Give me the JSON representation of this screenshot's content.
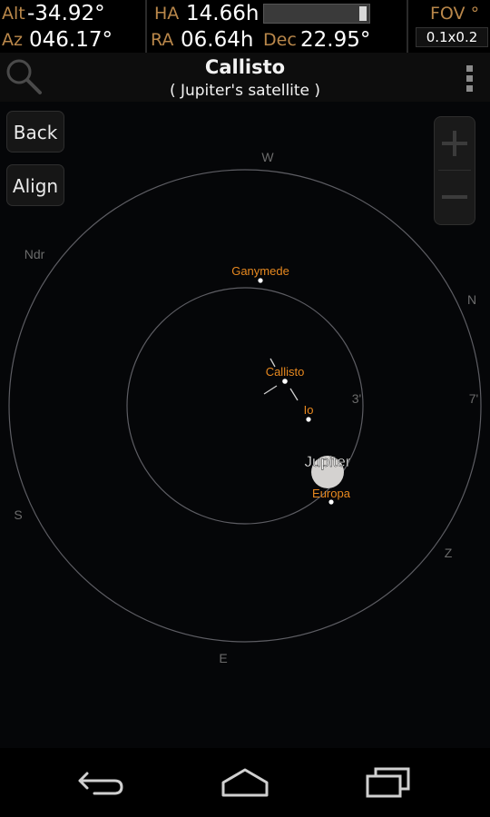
{
  "status": {
    "alt_label": "Alt",
    "alt_value": "-34.92°",
    "az_label": "Az",
    "az_value": "046.17°",
    "ha_label": "HA",
    "ha_value": "14.66h",
    "ra_label": "RA",
    "ra_value": "06.64h",
    "dec_label": "Dec",
    "dec_value": "22.95°",
    "fov_label": "FOV °",
    "fov_value": "0.1x0.2"
  },
  "header": {
    "title": "Callisto",
    "subtitle": "( Jupiter's satellite )"
  },
  "buttons": {
    "back": "Back",
    "align": "Align"
  },
  "sky": {
    "directions": {
      "w": "W",
      "n": "N",
      "s": "S",
      "e": "E",
      "z": "Z",
      "ndr": "Ndr"
    },
    "ring_labels": {
      "inner": "3'",
      "outer": "7'"
    },
    "objects": {
      "ganymede": "Ganymede",
      "callisto": "Callisto",
      "io": "Io",
      "jupiter": "Jupiter",
      "europa": "Europa"
    }
  },
  "colors": {
    "accent": "#e8891f",
    "label": "#b9874a"
  },
  "icons": {
    "search": "search-icon",
    "overflow": "overflow-menu-icon",
    "zoom_in": "zoom-in-icon",
    "zoom_out": "zoom-out-icon",
    "back_nav": "back-nav-icon",
    "home": "home-icon",
    "recents": "recents-icon"
  }
}
